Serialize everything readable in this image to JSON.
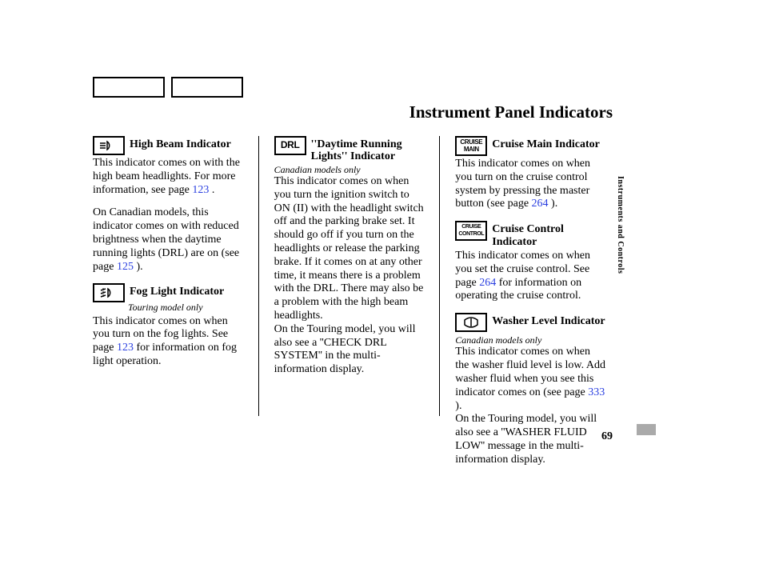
{
  "page_title": "Instrument Panel Indicators",
  "page_number": "69",
  "section_tab": "Instruments and Controls",
  "header_buttons": {
    "left": "",
    "right": ""
  },
  "col1": {
    "high_beam": {
      "title": "High Beam Indicator",
      "p1a": "This indicator comes on with the high beam headlights. For more information, see page ",
      "p1_link": "123",
      "p1b": " .",
      "p2a": "On Canadian models, this indicator comes on with reduced brightness when the daytime running lights (DRL) are on (see page ",
      "p2_link": "125",
      "p2b": " )."
    },
    "fog_light": {
      "title": "Fog Light Indicator",
      "note": "Touring model only",
      "p1a": "This indicator comes on when you turn on the fog lights. See page ",
      "p1_link": "123",
      "p1b": " for information on fog light operation."
    }
  },
  "col2": {
    "drl": {
      "icon_text": "DRL",
      "title": "''Daytime Running Lights'' Indicator",
      "note": "Canadian models only",
      "p1": "This indicator comes on when you turn the ignition switch to ON (II) with the headlight switch off and the parking brake set. It should go off if you turn on the headlights or release the parking brake. If it comes on at any other time, it means there is a problem with the DRL. There may also be a problem with the high beam headlights.",
      "p2": "On the Touring model, you will also see a ''CHECK DRL SYSTEM'' in the multi-information display."
    }
  },
  "col3": {
    "cruise_main": {
      "icon_text": "CRUISE MAIN",
      "title": "Cruise Main Indicator",
      "p1a": "This indicator comes on when you turn on the cruise control system by pressing the master button (see page ",
      "p1_link": "264",
      "p1b": " )."
    },
    "cruise_control": {
      "icon_text": "CRUISE CONTROL",
      "title": "Cruise Control Indicator",
      "p1a": "This indicator comes on when you set the cruise control. See page ",
      "p1_link": "264",
      "p1b": " for information on operating the cruise control."
    },
    "washer": {
      "title": "Washer Level Indicator",
      "note": "Canadian models only",
      "p1a": "This indicator comes on when the washer fluid level is low. Add washer fluid when you see this indicator comes on (see page ",
      "p1_link": "333",
      "p1b": " ).",
      "p2": "On the Touring model, you will also see a ''WASHER FLUID LOW'' message in the multi-information display."
    }
  }
}
